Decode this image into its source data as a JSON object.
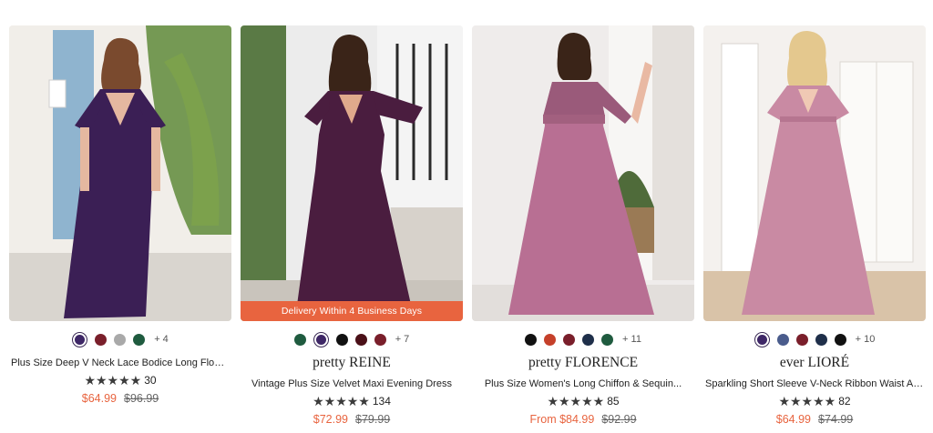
{
  "products": [
    {
      "brand": "",
      "name": "Plus Size Deep V Neck Lace Bodice Long Flowy...",
      "stars": "★★★★★",
      "reviews": "30",
      "price_now": "$64.99",
      "price_was": "$96.99",
      "swatches": [
        "#3e2766",
        "#7a1f2b",
        "#a9a9a9",
        "#1f5b3f"
      ],
      "more_colors": "+ 4",
      "dress_color": "#3b1f55"
    },
    {
      "brand": "pretty REINE",
      "name": "Vintage Plus Size Velvet Maxi Evening Dress",
      "stars": "★★★★★",
      "reviews": "134",
      "price_now": "$72.99",
      "price_was": "$79.99",
      "ribbon": "Delivery Within 4 Business Days",
      "swatches": [
        "#1f5b3f",
        "#3e2766",
        "#111111",
        "#4a1018",
        "#7a1f2b"
      ],
      "more_colors": "+ 7",
      "dress_color": "#4a1d3f"
    },
    {
      "brand": "pretty FLORENCE",
      "name": "Plus Size Women's Long Chiffon & Sequin...",
      "stars": "★★★★★",
      "reviews": "85",
      "price_now": "From $84.99",
      "price_was": "$92.99",
      "swatches": [
        "#111111",
        "#c5402a",
        "#7a1f2b",
        "#1f2f4a",
        "#1f5b3f"
      ],
      "more_colors": "+ 11",
      "dress_color": "#b86f93"
    },
    {
      "brand": "ever LIORÉ",
      "name": "Sparkling Short Sleeve V-Neck Ribbon Waist A-...",
      "stars": "★★★★★",
      "reviews": "82",
      "price_now": "$64.99",
      "price_was": "$74.99",
      "swatches": [
        "#3e2766",
        "#4a5c8c",
        "#7a1f2b",
        "#1f2f4a",
        "#111111"
      ],
      "more_colors": "+ 10",
      "dress_color": "#c98aa3"
    }
  ]
}
